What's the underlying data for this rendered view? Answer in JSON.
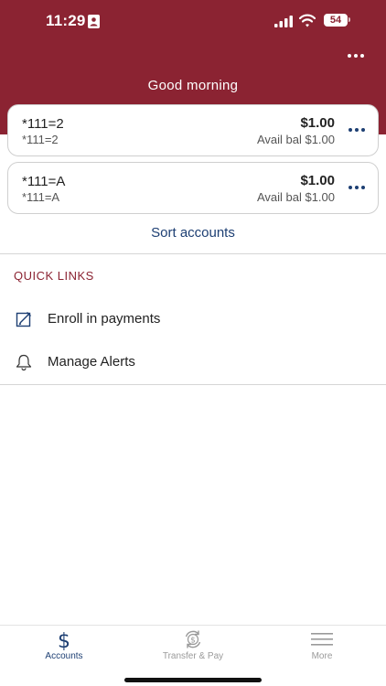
{
  "status_bar": {
    "time": "11:29",
    "battery": "54"
  },
  "header": {
    "greeting": "Good morning"
  },
  "accounts": [
    {
      "name": "*111=2",
      "number": "*111=2",
      "balance": "$1.00",
      "avail": "Avail bal $1.00"
    },
    {
      "name": "*111=A",
      "number": "*111=A",
      "balance": "$1.00",
      "avail": "Avail bal $1.00"
    }
  ],
  "sort_label": "Sort accounts",
  "quick_links": {
    "title": "QUICK LINKS",
    "items": [
      {
        "label": "Enroll in payments",
        "icon": "edit-icon"
      },
      {
        "label": "Manage Alerts",
        "icon": "bell-icon"
      }
    ]
  },
  "tabs": [
    {
      "label": "Accounts",
      "icon": "dollar-icon",
      "active": true
    },
    {
      "label": "Transfer & Pay",
      "icon": "transfer-icon",
      "active": false
    },
    {
      "label": "More",
      "icon": "menu-icon",
      "active": false
    }
  ],
  "colors": {
    "brand": "#8b2332",
    "link": "#1d3f73",
    "inactive": "#9a9a9a"
  }
}
